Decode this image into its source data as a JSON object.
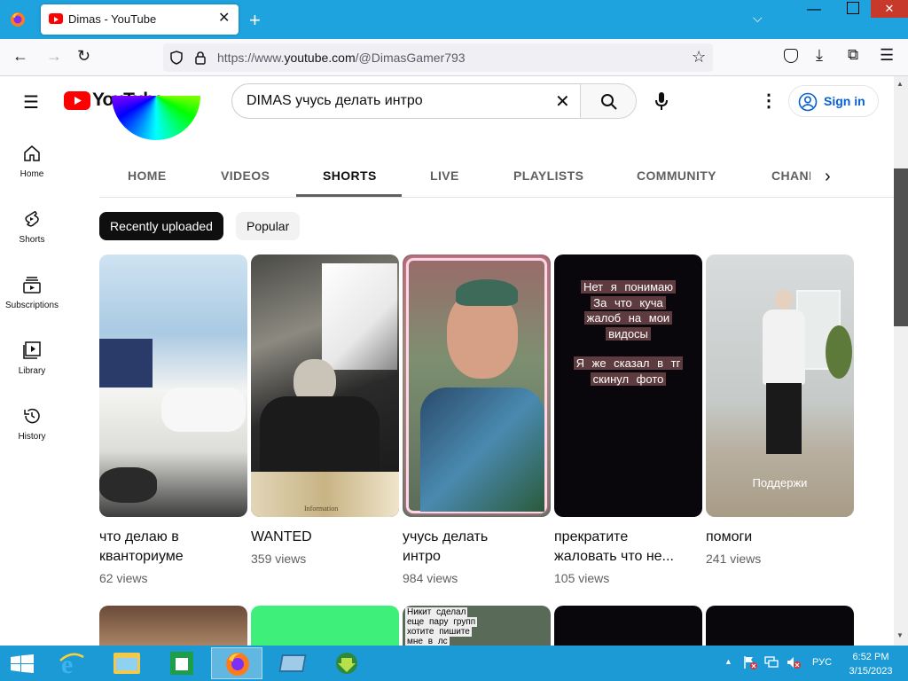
{
  "browser": {
    "tab_title": "Dimas - YouTube",
    "url_prefix": "https://www.",
    "url_domain": "youtube.com",
    "url_path": "/@DimasGamer793"
  },
  "youtube": {
    "logo_text": "YouTube",
    "search_value": "DIMAS учусь делать интро",
    "signin_label": "Sign in"
  },
  "sidebar": {
    "items": [
      {
        "label": "Home",
        "icon": "home-icon"
      },
      {
        "label": "Shorts",
        "icon": "shorts-icon"
      },
      {
        "label": "Subscriptions",
        "icon": "subscriptions-icon"
      },
      {
        "label": "Library",
        "icon": "library-icon"
      },
      {
        "label": "History",
        "icon": "history-icon"
      }
    ]
  },
  "channel_tabs": [
    "HOME",
    "VIDEOS",
    "SHORTS",
    "LIVE",
    "PLAYLISTS",
    "COMMUNITY",
    "CHANI"
  ],
  "active_tab": "SHORTS",
  "chips": {
    "recent": "Recently uploaded",
    "popular": "Popular"
  },
  "shorts": [
    {
      "title_1": "что делаю в",
      "title_2": "кванториуме",
      "views": "62 views"
    },
    {
      "title_1": "WANTED",
      "title_2": "",
      "views": "359 views",
      "overlay": "Information"
    },
    {
      "title_1": "учусь делать",
      "title_2": "интро",
      "views": "984 views"
    },
    {
      "title_1": "прекратите",
      "title_2": "жаловать что не...",
      "views": "105 views",
      "overlay_lines": [
        "Нет я понимаю",
        "За что куча",
        "жалоб на мои",
        "видосы",
        "",
        "Я же сказал в тг",
        "скинул фото"
      ]
    },
    {
      "title_1": "помоги",
      "title_2": "",
      "views": "241 views",
      "overlay": "Поддержи"
    }
  ],
  "row2_overlay": [
    "Никит сделал",
    "еще пару групп",
    "хотите пишите",
    "мне в лс"
  ],
  "taskbar": {
    "time": "6:52 PM",
    "date": "3/15/2023",
    "lang": "РУС"
  },
  "colors": {
    "yt_red": "#ff0000",
    "titlebar": "#1fa3df",
    "taskbar": "#1c9ad6",
    "link_blue": "#065fd4"
  }
}
